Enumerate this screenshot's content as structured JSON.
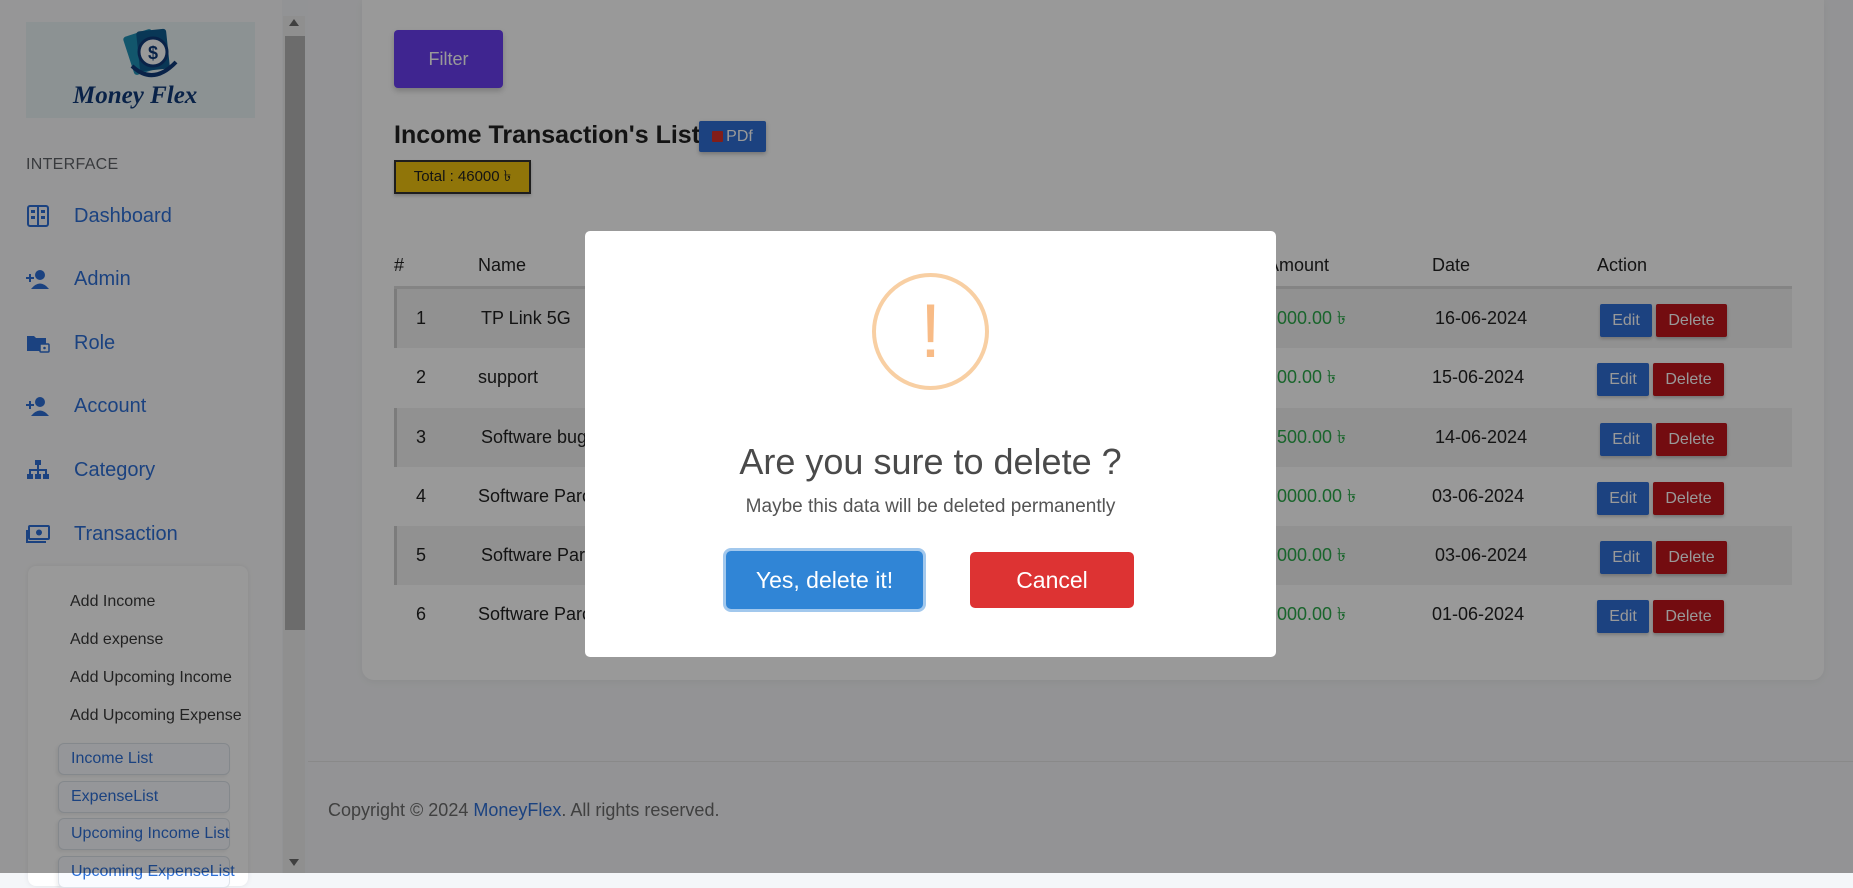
{
  "sidebar": {
    "logo_text": "Money Flex",
    "section_heading": "INTERFACE",
    "nav": [
      {
        "label": "Dashboard",
        "icon": "dashboard-icon"
      },
      {
        "label": "Admin",
        "icon": "user-plus-icon"
      },
      {
        "label": "Role",
        "icon": "folder-lock-icon"
      },
      {
        "label": "Account",
        "icon": "user-plus-icon"
      },
      {
        "label": "Category",
        "icon": "sitemap-icon"
      },
      {
        "label": "Transaction",
        "icon": "money-icon"
      }
    ],
    "submenu": [
      "Add Income",
      "Add expense",
      "Add Upcoming Income",
      "Add Upcoming Expense",
      "Income List",
      "ExpenseList",
      "Upcoming Income List",
      "Upcoming ExpenseList"
    ]
  },
  "toolbar": {
    "filter_label": "Filter",
    "list_title": "Income Transaction's List",
    "pdf_label": "PDf",
    "total_label": "Total : 46000 ৳"
  },
  "table": {
    "headers": [
      "#",
      "Name",
      "Amount",
      "Date",
      "Action"
    ],
    "rows": [
      {
        "no": "1",
        "name": "TP Link 5G",
        "amount": "000.00 ৳",
        "date": "16-06-2024"
      },
      {
        "no": "2",
        "name": "support",
        "amount": "00.00 ৳",
        "date": "15-06-2024"
      },
      {
        "no": "3",
        "name": "Software bug",
        "amount": "500.00 ৳",
        "date": "14-06-2024"
      },
      {
        "no": "4",
        "name": "Software Parc",
        "amount": "0000.00 ৳",
        "date": "03-06-2024"
      },
      {
        "no": "5",
        "name": "Software Parc",
        "amount": "000.00 ৳",
        "date": "03-06-2024"
      },
      {
        "no": "6",
        "name": "Software Parc",
        "amount": "000.00 ৳",
        "date": "01-06-2024"
      }
    ],
    "edit_label": "Edit",
    "delete_label": "Delete"
  },
  "footer": {
    "prefix": "Copyright © 2024 ",
    "brand": "MoneyFlex",
    "suffix": ". All rights reserved."
  },
  "dialog": {
    "icon_symbol": "!",
    "title": "Are you sure to delete ?",
    "text": "Maybe this data will be deleted permanently",
    "confirm_label": "Yes, delete it!",
    "cancel_label": "Cancel"
  },
  "colors": {
    "accent_blue": "#2f6fd5",
    "filter_purple": "#6a3ff1",
    "delete_red": "#c0141c",
    "amount_green": "#2ba84a",
    "total_yellow": "#f1c40f",
    "confirm_blue": "#3085d6",
    "cancel_red": "#dd3333",
    "warning_orange": "#f8bb86"
  }
}
